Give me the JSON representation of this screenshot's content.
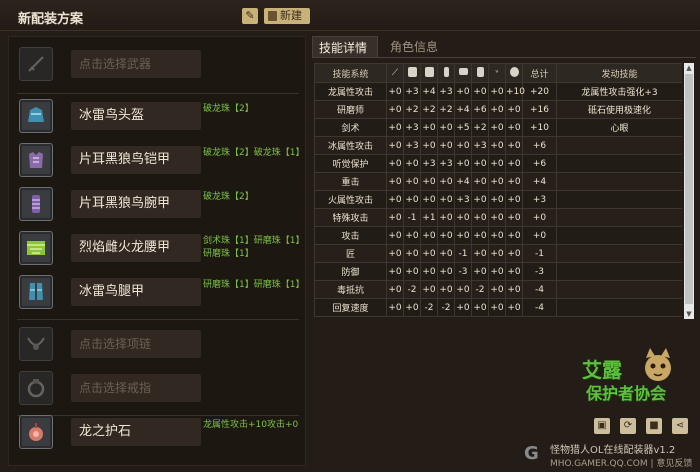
{
  "header": {
    "title": "新配装方案",
    "new_label": "新建"
  },
  "equipment": {
    "weapon": {
      "label": "点击选择武器"
    },
    "helmet": {
      "label": "冰雷鸟头盔",
      "gems": "破龙珠【2】"
    },
    "chest": {
      "label": "片耳黑狼鸟铠甲",
      "gems": "破龙珠【2】破龙珠【1】"
    },
    "arms": {
      "label": "片耳黑狼鸟腕甲",
      "gems": "破龙珠【2】"
    },
    "waist": {
      "label": "烈焰雌火龙腰甲",
      "gems": "剑术珠【1】研磨珠【1】研磨珠【1】"
    },
    "legs": {
      "label": "冰雷鸟腿甲",
      "gems": "研磨珠【1】研磨珠【1】"
    },
    "necklace": {
      "label": "点击选择项链"
    },
    "ring": {
      "label": "点击选择戒指"
    },
    "charm": {
      "label": "龙之护石",
      "gems": "龙属性攻击+10攻击+0"
    }
  },
  "tabs": {
    "skills": "技能详情",
    "character": "角色信息"
  },
  "skill_table": {
    "headers": [
      "技能系统",
      "总计",
      "发动技能"
    ],
    "rows": [
      {
        "name": "龙属性攻击",
        "v": [
          "+0",
          "+3",
          "+4",
          "+3",
          "+0",
          "+0",
          "+0",
          "+10"
        ],
        "total": "+20",
        "active": "龙属性攻击强化+3"
      },
      {
        "name": "研磨师",
        "v": [
          "+0",
          "+2",
          "+2",
          "+2",
          "+4",
          "+6",
          "+0",
          "+0"
        ],
        "total": "+16",
        "active": "砥石使用极速化"
      },
      {
        "name": "剑术",
        "v": [
          "+0",
          "+3",
          "+0",
          "+0",
          "+5",
          "+2",
          "+0",
          "+0"
        ],
        "total": "+10",
        "active": "心眼"
      },
      {
        "name": "冰属性攻击",
        "v": [
          "+0",
          "+3",
          "+0",
          "+0",
          "+0",
          "+3",
          "+0",
          "+0"
        ],
        "total": "+6",
        "active": ""
      },
      {
        "name": "听觉保护",
        "v": [
          "+0",
          "+0",
          "+3",
          "+3",
          "+0",
          "+0",
          "+0",
          "+0"
        ],
        "total": "+6",
        "active": ""
      },
      {
        "name": "重击",
        "v": [
          "+0",
          "+0",
          "+0",
          "+0",
          "+4",
          "+0",
          "+0",
          "+0"
        ],
        "total": "+4",
        "active": ""
      },
      {
        "name": "火属性攻击",
        "v": [
          "+0",
          "+0",
          "+0",
          "+0",
          "+3",
          "+0",
          "+0",
          "+0"
        ],
        "total": "+3",
        "active": ""
      },
      {
        "name": "特殊攻击",
        "v": [
          "+0",
          "-1",
          "+1",
          "+0",
          "+0",
          "+0",
          "+0",
          "+0"
        ],
        "total": "+0",
        "active": ""
      },
      {
        "name": "攻击",
        "v": [
          "+0",
          "+0",
          "+0",
          "+0",
          "+0",
          "+0",
          "+0",
          "+0"
        ],
        "total": "+0",
        "active": ""
      },
      {
        "name": "匠",
        "v": [
          "+0",
          "+0",
          "+0",
          "+0",
          "-1",
          "+0",
          "+0",
          "+0"
        ],
        "total": "-1",
        "active": ""
      },
      {
        "name": "防御",
        "v": [
          "+0",
          "+0",
          "+0",
          "+0",
          "-3",
          "+0",
          "+0",
          "+0"
        ],
        "total": "-3",
        "active": ""
      },
      {
        "name": "毒抵抗",
        "v": [
          "+0",
          "-2",
          "+0",
          "+0",
          "+0",
          "-2",
          "+0",
          "+0"
        ],
        "total": "-4",
        "active": ""
      },
      {
        "name": "回复速度",
        "v": [
          "+0",
          "+0",
          "-2",
          "-2",
          "+0",
          "+0",
          "+0",
          "+0"
        ],
        "total": "-4",
        "active": ""
      }
    ]
  },
  "logo": {
    "line1": "艾露",
    "line2": "保护者协会"
  },
  "footer": {
    "line1": "怪物猎人OL在线配装器v1.2",
    "line2": "MHO.GAMER.QQ.COM | 意见反馈"
  }
}
